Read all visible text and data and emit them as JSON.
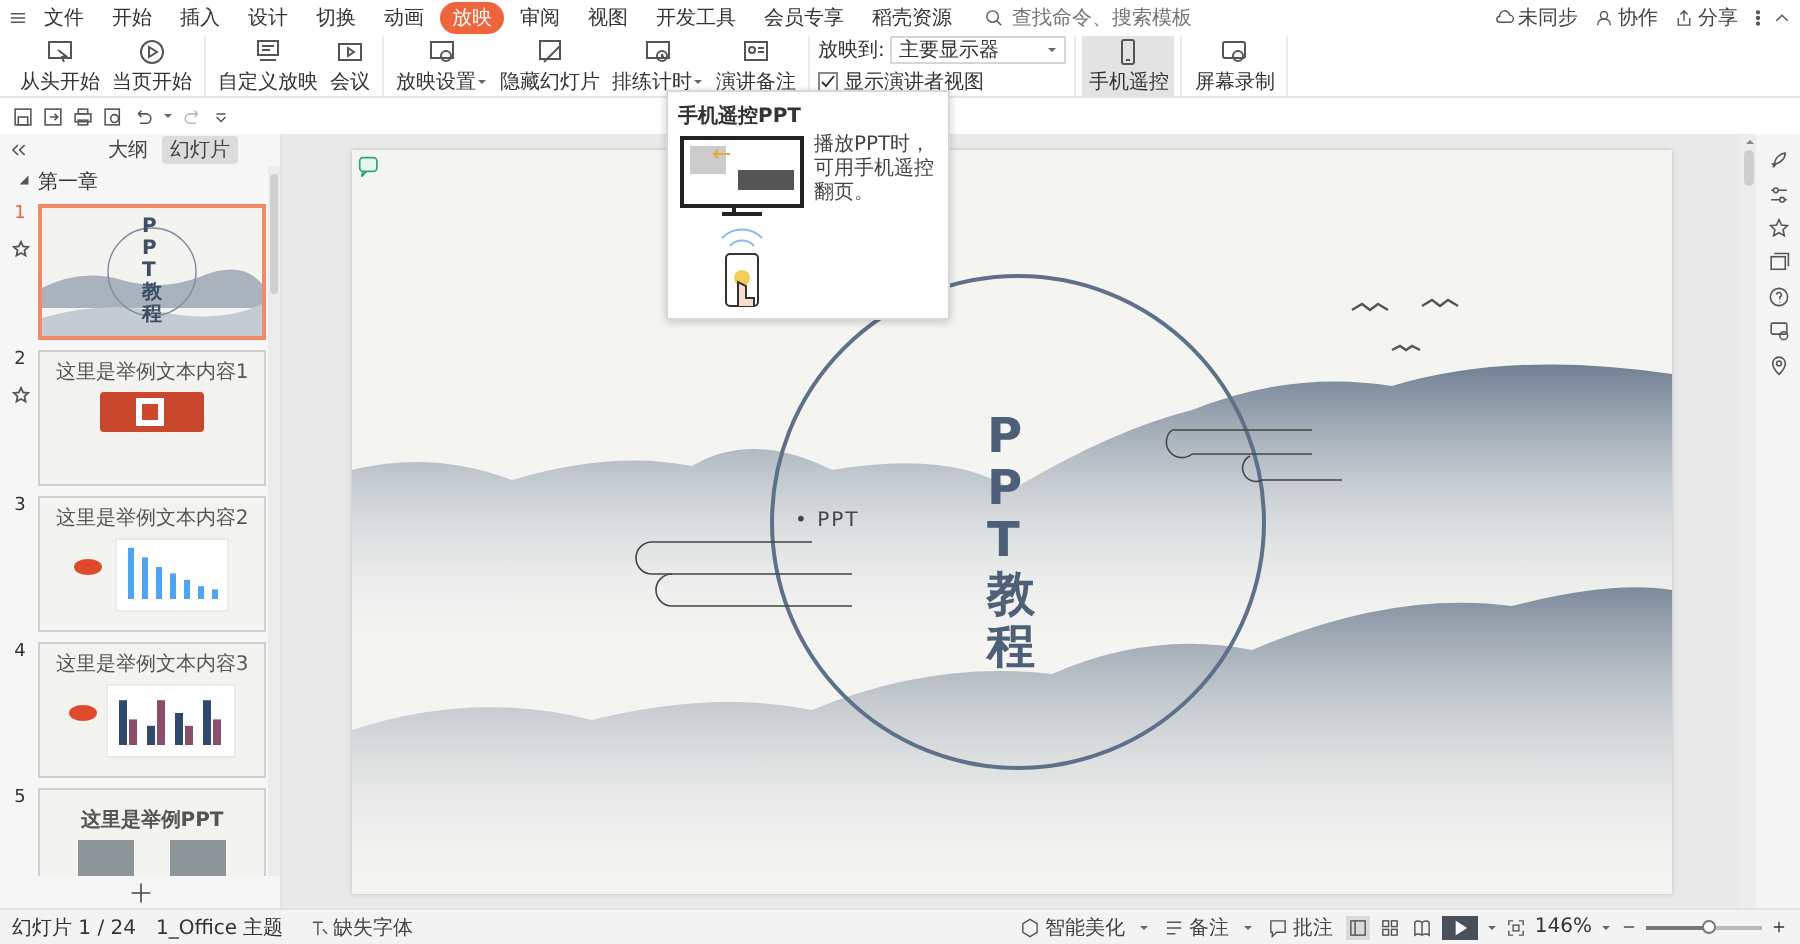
{
  "menu": {
    "items": [
      {
        "label": "文件",
        "selected": false
      },
      {
        "label": "开始",
        "selected": false
      },
      {
        "label": "插入",
        "selected": false
      },
      {
        "label": "设计",
        "selected": false
      },
      {
        "label": "切换",
        "selected": false
      },
      {
        "label": "动画",
        "selected": false
      },
      {
        "label": "放映",
        "selected": true
      },
      {
        "label": "审阅",
        "selected": false
      },
      {
        "label": "视图",
        "selected": false
      },
      {
        "label": "开发工具",
        "selected": false
      },
      {
        "label": "会员专享",
        "selected": false
      },
      {
        "label": "稻壳资源",
        "selected": false
      }
    ],
    "search": {
      "placeholder": "查找命令、搜索模板"
    },
    "actions": [
      "未同步",
      "协作",
      "分享"
    ]
  },
  "ribbon": [
    {
      "kind": "buttons",
      "buttons": [
        {
          "label": "从头开始",
          "dropdown": false,
          "selected": false
        },
        {
          "label": "当页开始",
          "dropdown": false,
          "selected": false
        }
      ]
    },
    {
      "kind": "buttons",
      "buttons": [
        {
          "label": "自定义放映",
          "dropdown": false,
          "selected": false
        },
        {
          "label": "会议",
          "dropdown": false,
          "selected": false
        }
      ]
    },
    {
      "kind": "buttons",
      "buttons": [
        {
          "label": "放映设置",
          "dropdown": true,
          "selected": false
        },
        {
          "label": "隐藏幻灯片",
          "dropdown": false,
          "selected": false
        },
        {
          "label": "排练计时",
          "dropdown": true,
          "selected": false
        },
        {
          "label": "演讲备注",
          "dropdown": false,
          "selected": false
        }
      ]
    },
    {
      "kind": "options",
      "target_label": "放映到:",
      "target_value": "主要显示器",
      "checkbox_label": "显示演讲者视图",
      "checked": true
    },
    {
      "kind": "buttons",
      "buttons": [
        {
          "label": "手机遥控",
          "dropdown": false,
          "selected": true
        }
      ]
    },
    {
      "kind": "buttons",
      "buttons": [
        {
          "label": "屏幕录制",
          "dropdown": false,
          "selected": false
        }
      ]
    }
  ],
  "tooltip": {
    "title": "手机遥控PPT",
    "text": "播放PPT时，可用手机遥控翻页。"
  },
  "panel": {
    "tabs": [
      {
        "label": "大纲",
        "selected": false
      },
      {
        "label": "幻灯片",
        "selected": true
      }
    ],
    "section": {
      "label": "第一章",
      "expanded": true
    },
    "slides": [
      {
        "number": "1",
        "kind": "title",
        "title": "PPT教程",
        "selected": true,
        "animated": true
      },
      {
        "number": "2",
        "kind": "logo",
        "title": "这里是举例文本内容1",
        "selected": false,
        "animated": true
      },
      {
        "number": "3",
        "kind": "bar-chart",
        "title": "这里是举例文本内容2",
        "selected": false,
        "animated": false
      },
      {
        "number": "4",
        "kind": "combo-chart",
        "title": "这里是举例文本内容3",
        "selected": false,
        "animated": false
      },
      {
        "number": "5",
        "kind": "cover",
        "title": "这里是举例PPT",
        "selected": false,
        "animated": false
      }
    ]
  },
  "slide": {
    "title": "PPT教程",
    "subtitle": "• PPT"
  },
  "status_bar": {
    "left": [
      "幻灯片 1 / 24",
      "1_Office 主题",
      "缺失字体"
    ],
    "beautify": "智能美化",
    "notes": "备注",
    "comments": "批注",
    "views": [
      {
        "selected": true
      },
      {
        "selected": false
      },
      {
        "selected": false
      }
    ],
    "zoom": "146%",
    "zoom_slider": {
      "level": 0.55
    }
  }
}
